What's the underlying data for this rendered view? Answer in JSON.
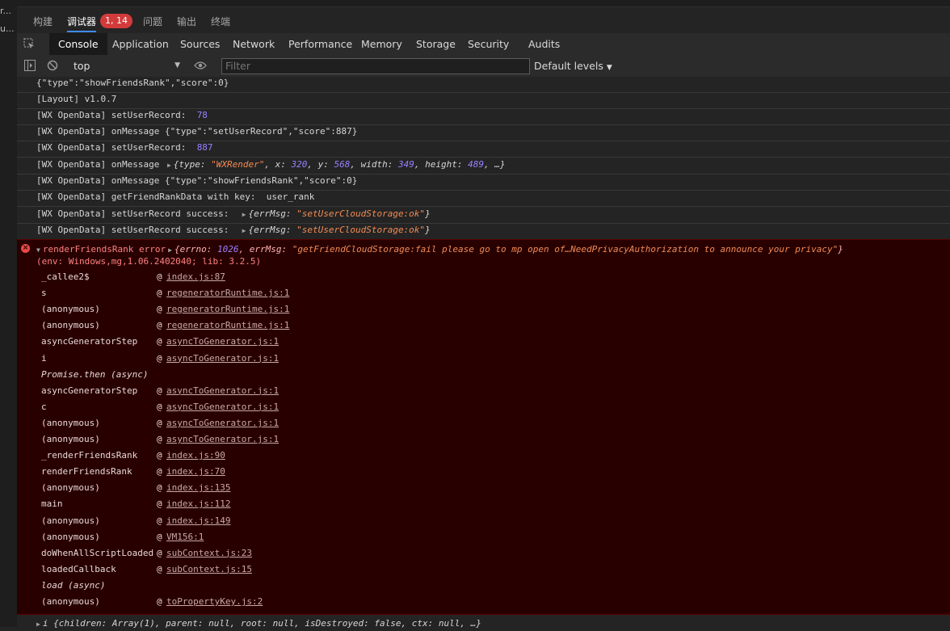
{
  "left_strip": [
    "r...",
    "u..."
  ],
  "ide_tabs": [
    {
      "label": "构建"
    },
    {
      "label": "调试器",
      "badge": "1, 14"
    },
    {
      "label": "问题"
    },
    {
      "label": "输出"
    },
    {
      "label": "终端"
    }
  ],
  "devtools_tabs": [
    "Console",
    "Application",
    "Sources",
    "Network",
    "Performance",
    "Memory",
    "Storage",
    "Security",
    "Audits"
  ],
  "toolbar": {
    "context": "top",
    "filter_placeholder": "Filter",
    "levels": "Default levels"
  },
  "logs": [
    "{\"type\":\"showFriendsRank\",\"score\":0}",
    "[Layout] v1.0.7",
    "[WX OpenData] setUserRecord:  ",
    "[WX OpenData] onMessage {\"type\":\"setUserRecord\",\"score\":887}",
    "[WX OpenData] setUserRecord:  ",
    "[WX OpenData] onMessage ",
    "[WX OpenData] onMessage {\"type\":\"showFriendsRank\",\"score\":0}",
    "[WX OpenData] getFriendRankData with key:  user_rank",
    "[WX OpenData] setUserRecord success:  ",
    "[WX OpenData] setUserRecord success:  "
  ],
  "values": {
    "record1": "78",
    "record2": "887",
    "render_type": "\"WXRender\"",
    "render_x": "320",
    "render_y": "568",
    "render_w": "349",
    "render_h": "489",
    "errmsg_ok": "\"setUserCloudStorage:ok\""
  },
  "error": {
    "label": "renderFriendsRank error",
    "errno": "1026",
    "errmsg": "\"getFriendCloudStorage:fail please go to mp open of…NeedPrivacyAuthorization to announce your privacy\"",
    "env": "(env: Windows,mg,1.06.2402040; lib: 3.2.5)",
    "frames": [
      {
        "fn": "_callee2$",
        "loc": "index.js:87"
      },
      {
        "fn": "s",
        "loc": "regeneratorRuntime.js:1"
      },
      {
        "fn": "(anonymous)",
        "loc": "regeneratorRuntime.js:1"
      },
      {
        "fn": "(anonymous)",
        "loc": "regeneratorRuntime.js:1"
      },
      {
        "fn": "asyncGeneratorStep",
        "loc": "asyncToGenerator.js:1"
      },
      {
        "fn": "i",
        "loc": "asyncToGenerator.js:1"
      },
      {
        "fn": "Promise.then (async)",
        "async": true
      },
      {
        "fn": "asyncGeneratorStep",
        "loc": "asyncToGenerator.js:1"
      },
      {
        "fn": "c",
        "loc": "asyncToGenerator.js:1"
      },
      {
        "fn": "(anonymous)",
        "loc": "asyncToGenerator.js:1"
      },
      {
        "fn": "(anonymous)",
        "loc": "asyncToGenerator.js:1"
      },
      {
        "fn": "_renderFriendsRank",
        "loc": "index.js:90"
      },
      {
        "fn": "renderFriendsRank",
        "loc": "index.js:70"
      },
      {
        "fn": "(anonymous)",
        "loc": "index.js:135"
      },
      {
        "fn": "main",
        "loc": "index.js:112"
      },
      {
        "fn": "(anonymous)",
        "loc": "index.js:149"
      },
      {
        "fn": "(anonymous)",
        "loc": "VM156:1"
      },
      {
        "fn": "doWhenAllScriptLoaded",
        "loc": "subContext.js:23"
      },
      {
        "fn": "loadedCallback",
        "loc": "subContext.js:15"
      },
      {
        "fn": "load (async)",
        "async": true
      },
      {
        "fn": "(anonymous)",
        "loc": "toPropertyKey.js:2"
      }
    ]
  },
  "bottom_log": "i {children: Array(1), parent: null, root: null, isDestroyed: false, ctx: null, …}"
}
